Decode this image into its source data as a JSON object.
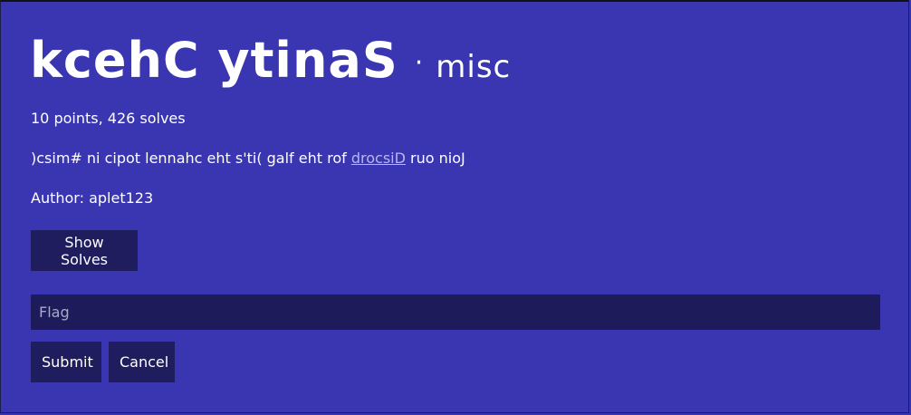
{
  "challenge": {
    "title": "kcehC ytinaS",
    "separator": "·",
    "category": "misc",
    "stats": "10 points, 426 solves",
    "description_before": ")csim# ni cipot lennahc eht s'ti( galf eht rof ",
    "description_link": "drocsiD",
    "description_after": " ruo nioJ",
    "author": "Author: aplet123"
  },
  "buttons": {
    "show_solves": "Show Solves",
    "submit": "Submit",
    "cancel": "Cancel"
  },
  "flag_input": {
    "placeholder": "Flag",
    "value": ""
  },
  "colors": {
    "background": "#3a36b1",
    "button": "#1f1d5e",
    "input": "#1e1b5a",
    "link": "#b9b6e8"
  }
}
